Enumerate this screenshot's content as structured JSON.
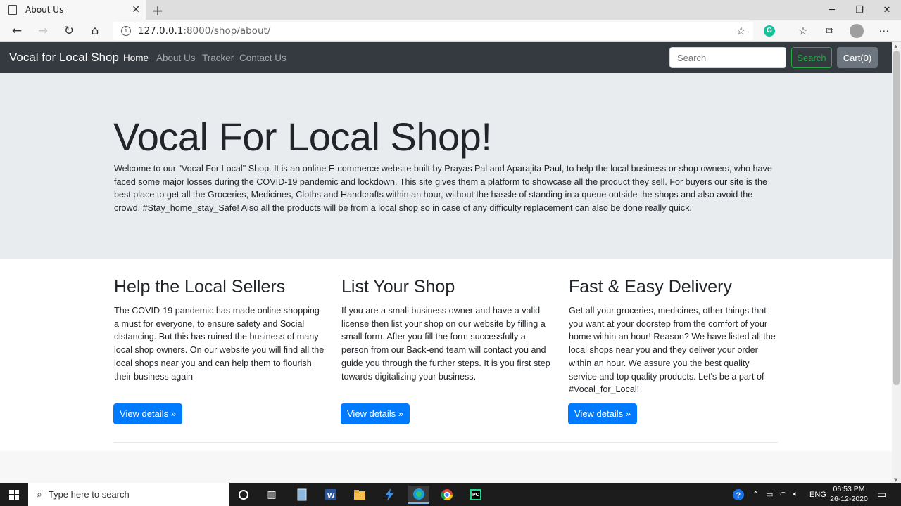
{
  "browser": {
    "tab_title": "About Us",
    "url_host": "127.0.0.1",
    "url_path": ":8000/shop/about/"
  },
  "navbar": {
    "brand": "Vocal for Local Shop",
    "links": [
      "Home",
      "About Us",
      "Tracker",
      "Contact Us"
    ],
    "search_placeholder": "Search",
    "search_button": "Search",
    "cart_button": "Cart(0)"
  },
  "jumbotron": {
    "title": "Vocal For Local Shop!",
    "text": "Welcome to our \"Vocal For Local\" Shop. It is an online E-commerce website built by Prayas Pal and Aparajita Paul, to help the local business or shop owners, who have faced some major losses during the COVID-19 pandemic and lockdown. This site gives them a platform to showcase all the product they sell. For buyers our site is the best place to get all the Groceries, Medicines, Cloths and Handcrafts within an hour, without the hassle of standing in a queue outside the shops and also avoid the crowd. #Stay_home_stay_Safe! Also all the products will be from a local shop so in case of any difficulty replacement can also be done really quick."
  },
  "features": [
    {
      "heading": "Help the Local Sellers",
      "text": "The COVID-19 pandemic has made online shopping a must for everyone, to ensure safety and Social distancing. But this has ruined the business of many local shop owners. On our website you will find all the local shops near you and can help them to flourish their business again",
      "button": "View details »"
    },
    {
      "heading": "List Your Shop",
      "text": "If you are a small business owner and have a valid license then list your shop on our website by filling a small form. After you fill the form successfully a person from our Back-end team will contact you and guide you through the further steps. It is you first step towards digitalizing your business.",
      "button": "View details »"
    },
    {
      "heading": "Fast & Easy Delivery",
      "text": "Get all your groceries, medicines, other things that you want at your doorstep from the comfort of your home within an hour! Reason? We have listed all the local shops near you and they deliver your order within an hour. We assure you the best quality service and top quality products. Let's be a part of #Vocal_for_Local!",
      "button": "View details »"
    }
  ],
  "taskbar": {
    "search_placeholder": "Type here to search",
    "language": "ENG",
    "time": "06:53 PM",
    "date": "26-12-2020"
  },
  "colors": {
    "navbar_bg": "#343a40",
    "jumbotron_bg": "#e9ecef",
    "primary": "#007bff",
    "success": "#28a745",
    "secondary": "#6c757d"
  }
}
